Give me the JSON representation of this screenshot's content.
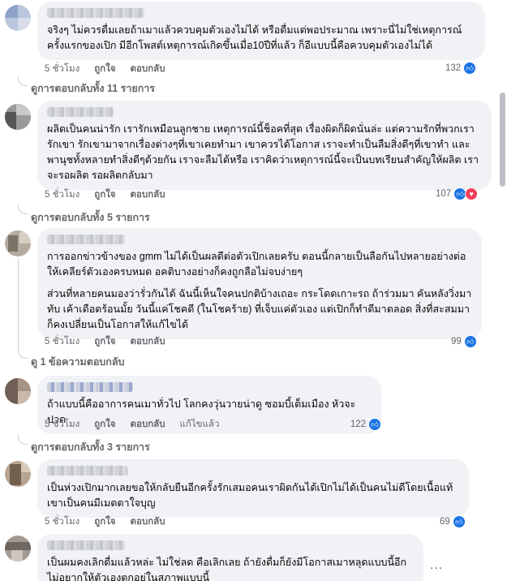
{
  "comments": [
    {
      "text": [
        "จริงๆ ไม่ควรดื่มเลยถ้าเมาแล้วควบคุมตัวเองไม่ได้ หรือดื่มแต่พอประมาณ เพราะนี่ไม่ใช่เหตุการณ์ครั้งแรกของเปิก มีอีกโพสต์เหตุการณ์เกิดขึ้นเมื่อ10ปีที่แล้ว ก็อีแบบนี้คือควบคุมตัวเองไม่ได้"
      ],
      "time": "5 ชั่วโมง",
      "like": "ถูกใจ",
      "reply": "ตอบกลับ",
      "reaction_count": "132",
      "view_replies": "ดูการตอบกลับทั้ง 11 รายการ"
    },
    {
      "text": [
        "ผลิตเป็นคนน่ารัก เรารักเหมือนลูกชาย เหตุการณ์นี้ช็อคที่สุด เรื่องผิดก็ผิดนั่นล่ะ แต่ความรักที่พวกเรารักเขา รักเขามาจากเรื่องต่างๆที่เขาเคยทำมา เขาควรได้โอกาส เราจะทำเป็นลืมสิ่งดีๆที่เขาทำ และพานุชทั้งหลายทำสิ่งดีๆด้วยกัน เราจะลืมได้หรือ เราคิดว่าเหตุการณ์นี้จะเป็นบทเรียนสำคัญให้ผลิต เราจะรอผลิต รอผลิตกลับมา"
      ],
      "time": "5 ชั่วโมง",
      "like": "ถูกใจ",
      "reply": "ตอบกลับ",
      "reaction_count": "107",
      "view_replies": "ดูการตอบกลับทั้ง 5 รายการ"
    },
    {
      "text": [
        "การออกข่าวข้างของ gmm ไม่ได้เป็นผลดีต่อตัวเปิกเลยครับ ตอนนี้กลายเป็นลือกันไปหลายอย่างต่อให้เคลียร์ตัวเองครบหมด อคติบางอย่างก็คงถูกลือไม่จบง่ายๆ",
        "ส่วนที่หลายคนมองว่ารั่วกันได้ ฉันนี้เห็นใจคนปกติบ้างเถอะ กระโดดเกาะรถ ถ้าร่วมมา คันหลังวิ่งมาทับ เค้าเดือดร้อนมั้ย วันนี้แค่โชคดี (ในโชคร้าย) ที่เจ็บแค่ตัวเอง แต่เปิกก็ทำดีมาตลอด สิ่งที่สะสมมาก็คงเปลี่ยนเป็นโอกาสให้แก้ไขได้"
      ],
      "time": "5 ชั่วโมง",
      "like": "ถูกใจ",
      "reply": "ตอบกลับ",
      "reaction_count": "99",
      "view_replies": "ดู 1 ข้อความตอบกลับ"
    },
    {
      "text": [
        "ถ้าแบบนี้คืออาการคนเมาทั่วไป โลกคงวุ่นวายน่าดู ซอมบี้เต็มเมือง หัวจะปวด"
      ],
      "time": "5 ชั่วโมง",
      "like": "ถูกใจ",
      "reply": "ตอบกลับ",
      "edited": "แก้ไขแล้ว",
      "reaction_count": "122",
      "view_replies": "ดูการตอบกลับทั้ง 3 รายการ"
    },
    {
      "text": [
        "เป็นห่วงเปิกมากเลยขอให้กลับยืนอีกครั้งรักเสมอคนเราผิดกันได้เปิกไม่ได้เป็นคนไม่ดีโดยเนื้อแท้ เขาเป็นคนมีเมตตาใจบุญ"
      ],
      "time": "5 ชั่วโมง",
      "like": "ถูกใจ",
      "reply": "ตอบกลับ",
      "reaction_count": "69"
    },
    {
      "text": [
        "เป็นผมคงเลิกดื่มแล้วหล่ะ ไม่ใช่ลด คือเลิกเลย ถ้ายังดื่มก็ยังมีโอกาสเมาหลุดแบบนี้อีก ไม่อยากให้ตัวเองตกอยู่ในสภาพแบบนี้"
      ]
    }
  ],
  "more_options": "...",
  "icons": {
    "like": "thumbs-up-icon",
    "love": "heart-icon"
  },
  "colors": {
    "like": "#1b74e4",
    "love": "#f33e58",
    "bubble": "#f0f2f5",
    "meta": "#65676b"
  }
}
